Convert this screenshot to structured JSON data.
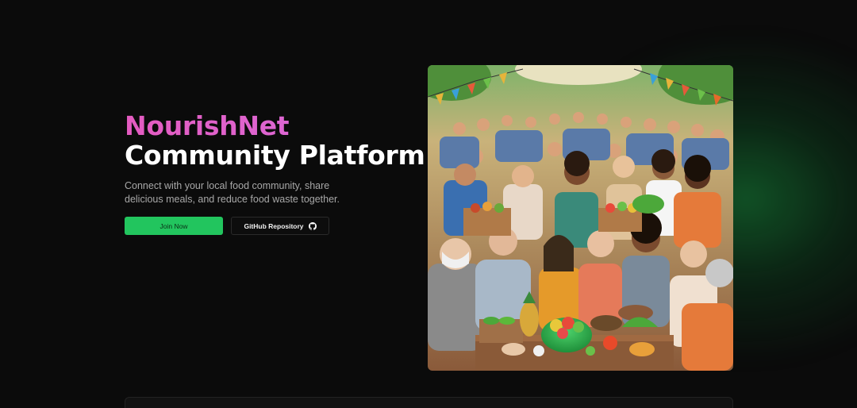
{
  "hero": {
    "brand": "NourishNet",
    "headline": "Community Platform",
    "subtitle": "Connect with your local food community, share delicious meals, and reduce food waste together.",
    "primary_button": "Join Now",
    "secondary_button": "GitHub Repository",
    "secondary_icon": "github-icon"
  },
  "image": {
    "icon": "community-food-sharing-illustration"
  },
  "colors": {
    "accent": "#22c55e",
    "brand_gradient_start": "#e45bc0",
    "brand_gradient_end": "#d86ee0",
    "background": "#0b0b0b"
  }
}
